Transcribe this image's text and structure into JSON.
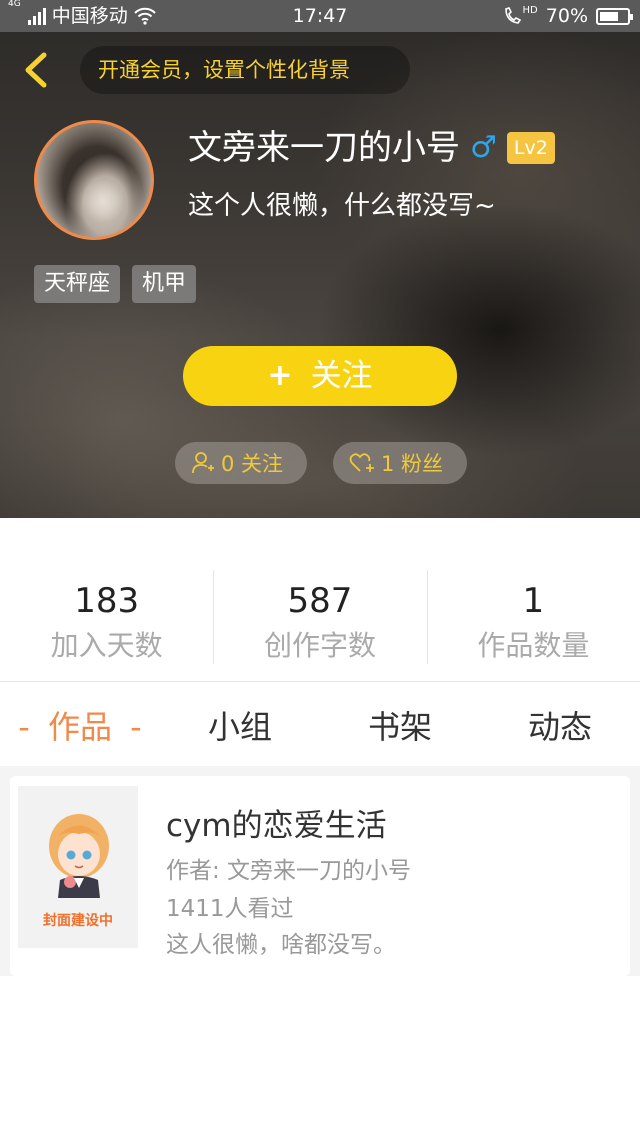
{
  "status_bar": {
    "network_type": "4G",
    "carrier": "中国移动",
    "time": "17:47",
    "hd_label": "HD",
    "battery_percent": "70%",
    "battery_level": 0.7
  },
  "header": {
    "vip_banner": "开通会员，设置个性化背景"
  },
  "profile": {
    "username": "文旁来一刀的小号",
    "gender_symbol": "♂",
    "level": "Lv2",
    "bio": "这个人很懒，什么都没写~",
    "tags": [
      "天秤座",
      "机甲"
    ],
    "follow_plus": "+",
    "follow_label": "关注",
    "following_text": "0 关注",
    "fans_text": "1 粉丝"
  },
  "stats": [
    {
      "value": "183",
      "label": "加入天数"
    },
    {
      "value": "587",
      "label": "创作字数"
    },
    {
      "value": "1",
      "label": "作品数量"
    }
  ],
  "tabs": {
    "active_dash": "-",
    "items": [
      "作品",
      "小组",
      "书架",
      "动态"
    ]
  },
  "works": [
    {
      "cover_text": "封面建设中",
      "title": "cym的恋爱生活",
      "author": "作者: 文旁来一刀的小号",
      "views": "1411人看过",
      "description": "这人很懒，啥都没写。"
    }
  ],
  "colors": {
    "accent_orange": "#f08a4b",
    "follow_yellow": "#f7d311",
    "pill_text": "#f0c93a",
    "male_blue": "#2fa6e8",
    "level_badge": "#f5c542"
  }
}
